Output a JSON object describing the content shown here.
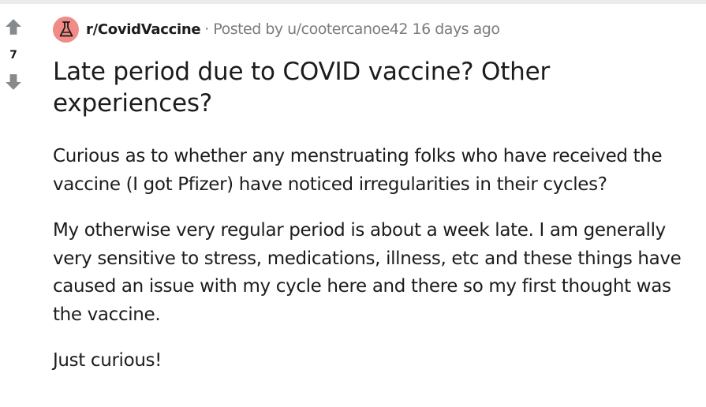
{
  "vote": {
    "count": "7",
    "upvote_icon": "arrow-up-icon",
    "downvote_icon": "arrow-down-icon"
  },
  "meta": {
    "subreddit": "r/CovidVaccine",
    "separator": "·",
    "posted_by": "Posted by u/cootercanoe42 16 days ago",
    "subreddit_icon": "flask-icon",
    "subreddit_icon_color": "#f08b86"
  },
  "post": {
    "title": "Late period due to COVID vaccine? Other experiences?",
    "paragraphs": [
      "Curious as to whether any menstruating folks who have received the vaccine (I got Pfizer) have noticed irregularities in their cycles?",
      "My otherwise very regular period is about a week late. I am generally very sensitive to stress, medications, illness, etc and these things have caused an issue with my cycle here and there so my first thought was the vaccine.",
      "Just curious!"
    ]
  },
  "colors": {
    "vote_arrow": "#878a8c",
    "meta_text": "#7c7c7c",
    "text": "#1c1c1c"
  }
}
